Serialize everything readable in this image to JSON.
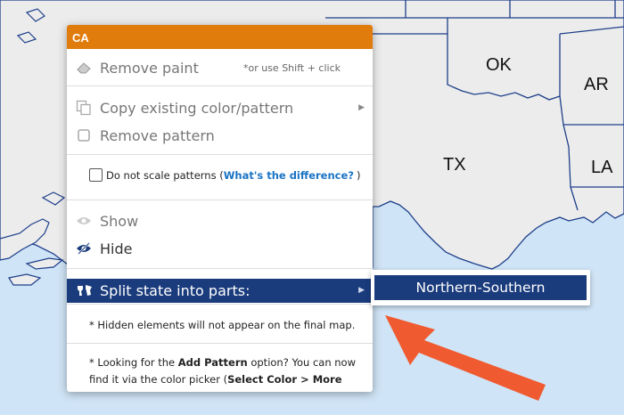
{
  "map": {
    "state_labels": [
      {
        "id": "ok",
        "text": "OK"
      },
      {
        "id": "ar",
        "text": "AR"
      },
      {
        "id": "tx",
        "text": "TX"
      },
      {
        "id": "la",
        "text": "LA"
      }
    ],
    "colors": {
      "water": "#cfe4f6",
      "land": "#ececec",
      "border": "#1e3f8a"
    }
  },
  "menu": {
    "title": "CA",
    "remove_paint": {
      "label": "Remove paint",
      "hint": "*or use Shift + click",
      "icon": "eraser-icon"
    },
    "copy_existing": {
      "label": "Copy existing color/pattern",
      "icon": "copy-icon"
    },
    "remove_pattern": {
      "label": "Remove pattern",
      "icon": "square-icon"
    },
    "scale_option": {
      "label": "Do not scale patterns (",
      "link": "What's the difference?",
      "suffix": ")",
      "checked": false
    },
    "show": {
      "label": "Show",
      "icon": "eye-icon"
    },
    "hide": {
      "label": "Hide",
      "icon": "eye-slash-icon"
    },
    "split": {
      "label": "Split state into parts:",
      "icon": "split-state-icon"
    },
    "note_hidden": "* Hidden elements will not appear on the final map.",
    "note_pattern": {
      "p1": "* Looking for the ",
      "b1": "Add Pattern",
      "p2": " option? You can now find it via the color picker (",
      "b2": "Select Color > More patterns",
      "p3": ")."
    },
    "colors": {
      "header": "#e07c0c",
      "selected": "#1a3b7c",
      "link": "#1a73c4"
    }
  },
  "submenu": {
    "option": "Northern-Southern"
  },
  "annotation": {
    "arrow_color": "#f05a30"
  }
}
